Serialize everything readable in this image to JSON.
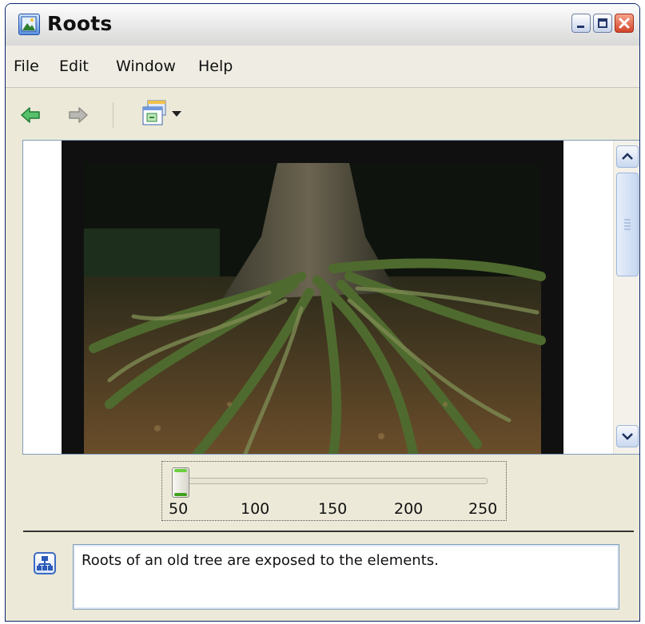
{
  "window": {
    "title": "Roots"
  },
  "menubar": {
    "items": [
      "File",
      "Edit",
      "Window",
      "Help"
    ]
  },
  "toolbar": {
    "back_icon": "back-arrow-icon",
    "forward_icon": "forward-arrow-icon",
    "view_icon": "window-view-icon",
    "accent": "#2aa84a"
  },
  "slider": {
    "ticks": [
      "50",
      "100",
      "150",
      "200",
      "250"
    ],
    "min": 50,
    "max": 250,
    "value": 50
  },
  "caption": {
    "icon": "sitemap-icon",
    "text": "Roots of an old tree are exposed to the elements."
  }
}
